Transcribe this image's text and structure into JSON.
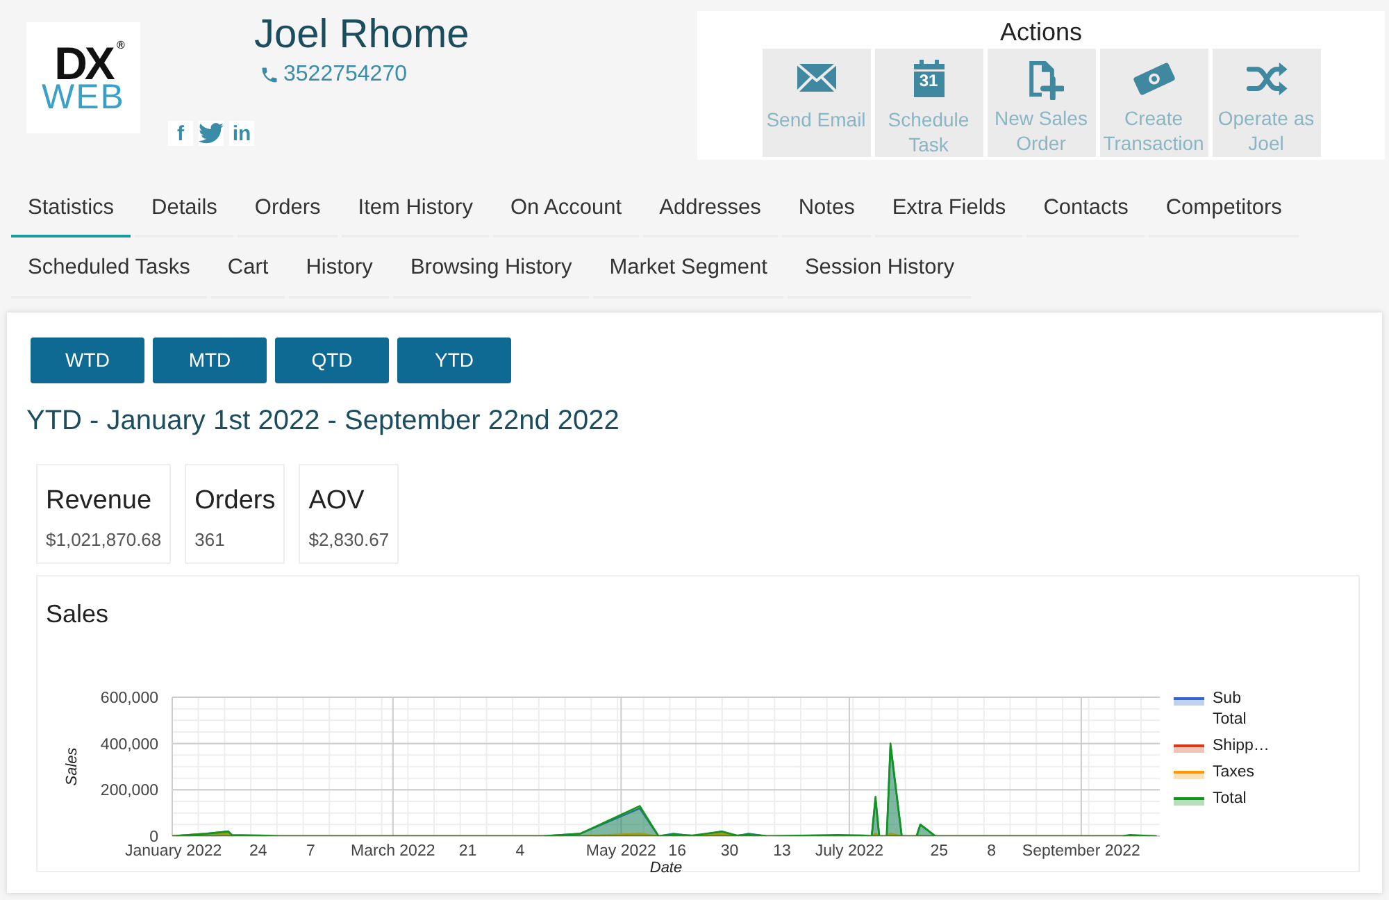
{
  "logo": {
    "line1": "DX",
    "line2": "WEB",
    "mark": "®"
  },
  "contact": {
    "name": "Joel Rhome",
    "phone": "3522754270"
  },
  "social": [
    {
      "kind": "facebook",
      "label": "f"
    },
    {
      "kind": "twitter"
    },
    {
      "kind": "linkedin",
      "label": "in"
    }
  ],
  "actions": {
    "title": "Actions",
    "items": [
      {
        "kind": "email",
        "label": "Send Email"
      },
      {
        "kind": "calendar",
        "label": "Schedule Task",
        "icon_text": "31"
      },
      {
        "kind": "document-plus",
        "label": "New Sales Order"
      },
      {
        "kind": "money",
        "label": "Create Transaction"
      },
      {
        "kind": "shuffle",
        "label": "Operate as Joel"
      }
    ]
  },
  "tab_rows": [
    [
      {
        "label": "Statistics",
        "selected": true
      },
      {
        "label": "Details",
        "selected": false
      },
      {
        "label": "Orders",
        "selected": false
      },
      {
        "label": "Item History",
        "selected": false
      },
      {
        "label": "On Account",
        "selected": false
      },
      {
        "label": "Addresses",
        "selected": false
      },
      {
        "label": "Notes",
        "selected": false
      },
      {
        "label": "Extra Fields",
        "selected": false
      },
      {
        "label": "Contacts",
        "selected": false
      },
      {
        "label": "Competitors",
        "selected": false
      }
    ],
    [
      {
        "label": "Scheduled Tasks",
        "selected": false
      },
      {
        "label": "Cart",
        "selected": false
      },
      {
        "label": "History",
        "selected": false
      },
      {
        "label": "Browsing History",
        "selected": false
      },
      {
        "label": "Market Segment",
        "selected": false
      },
      {
        "label": "Session History",
        "selected": false
      }
    ]
  ],
  "periods": [
    "WTD",
    "MTD",
    "QTD",
    "YTD"
  ],
  "heading": "YTD - January 1st 2022 - September 22nd 2022",
  "stats": [
    {
      "label": "Revenue",
      "value": "$1,021,870.68"
    },
    {
      "label": "Orders",
      "value": "361"
    },
    {
      "label": "AOV",
      "value": "$2,830.67"
    }
  ],
  "sales": {
    "title": "Sales",
    "chart_data": {
      "type": "area",
      "xlabel": "Date",
      "ylabel": "Sales",
      "x": [
        "2022-01-01",
        "2022-01-10",
        "2022-01-16",
        "2022-01-17",
        "2022-01-25",
        "2022-01-30",
        "2022-04-10",
        "2022-04-20",
        "2022-05-06",
        "2022-05-11",
        "2022-05-15",
        "2022-05-20",
        "2022-05-28",
        "2022-06-01",
        "2022-06-04",
        "2022-06-09",
        "2022-06-28",
        "2022-07-05",
        "2022-07-07",
        "2022-07-08",
        "2022-07-09",
        "2022-07-11",
        "2022-07-12",
        "2022-07-15",
        "2022-07-19",
        "2022-07-20",
        "2022-07-24",
        "2022-09-12",
        "2022-09-14",
        "2022-09-21"
      ],
      "series": [
        {
          "name": "Sub Total",
          "color": "#3366cc",
          "values": [
            0,
            10000,
            20000,
            0,
            0,
            0,
            0,
            10000,
            120000,
            0,
            10000,
            0,
            20000,
            0,
            10000,
            0,
            0,
            0,
            0,
            160000,
            0,
            0,
            390000,
            0,
            0,
            50000,
            0,
            0,
            0,
            0
          ]
        },
        {
          "name": "Shipp…",
          "color": "#dc3912",
          "values": [
            null,
            null,
            null,
            null,
            null,
            null,
            null,
            null,
            null,
            null,
            null,
            null,
            null,
            null,
            null,
            null,
            null,
            null,
            null,
            null,
            null,
            null,
            null,
            null,
            null,
            null,
            null,
            null,
            null,
            null
          ]
        },
        {
          "name": "Taxes",
          "color": "#ff9900",
          "values": [
            0,
            10000,
            10000,
            0,
            0,
            0,
            0,
            0,
            10000,
            0,
            0,
            0,
            10000,
            0,
            0,
            0,
            0,
            0,
            0,
            10000,
            0,
            0,
            10000,
            0,
            0,
            0,
            0,
            0,
            0,
            0
          ]
        },
        {
          "name": "Total",
          "color": "#109618",
          "values": [
            0,
            10000,
            20000,
            5000,
            3000,
            0,
            0,
            10000,
            130000,
            0,
            8000,
            3000,
            20000,
            3000,
            8000,
            0,
            5000,
            3000,
            0,
            170000,
            0,
            0,
            400000,
            0,
            0,
            50000,
            0,
            0,
            5000,
            0
          ]
        }
      ],
      "xlim": [
        "2022-01-01",
        "2022-09-22"
      ],
      "ylim": [
        0,
        600000
      ],
      "grid": true,
      "legend": true,
      "xticks": [
        {
          "value": "2022-01-01",
          "label": "January 2022"
        },
        {
          "value": "2022-01-24",
          "label": "24"
        },
        {
          "value": "2022-02-07",
          "label": "7"
        },
        {
          "value": "2022-03-01",
          "label": "March 2022"
        },
        {
          "value": "2022-03-21",
          "label": "21"
        },
        {
          "value": "2022-04-04",
          "label": "4"
        },
        {
          "value": "2022-05-01",
          "label": "May 2022"
        },
        {
          "value": "2022-05-16",
          "label": "16"
        },
        {
          "value": "2022-05-30",
          "label": "30"
        },
        {
          "value": "2022-06-13",
          "label": "13"
        },
        {
          "value": "2022-07-01",
          "label": "July 2022"
        },
        {
          "value": "2022-07-25",
          "label": "25"
        },
        {
          "value": "2022-08-08",
          "label": "8"
        },
        {
          "value": "2022-09-01",
          "label": "September 2022"
        }
      ],
      "yticks": [
        {
          "value": 0,
          "label": "0"
        },
        {
          "value": 200000,
          "label": "200,000"
        },
        {
          "value": 400000,
          "label": "400,000"
        },
        {
          "value": 600000,
          "label": "600,000"
        }
      ]
    }
  }
}
